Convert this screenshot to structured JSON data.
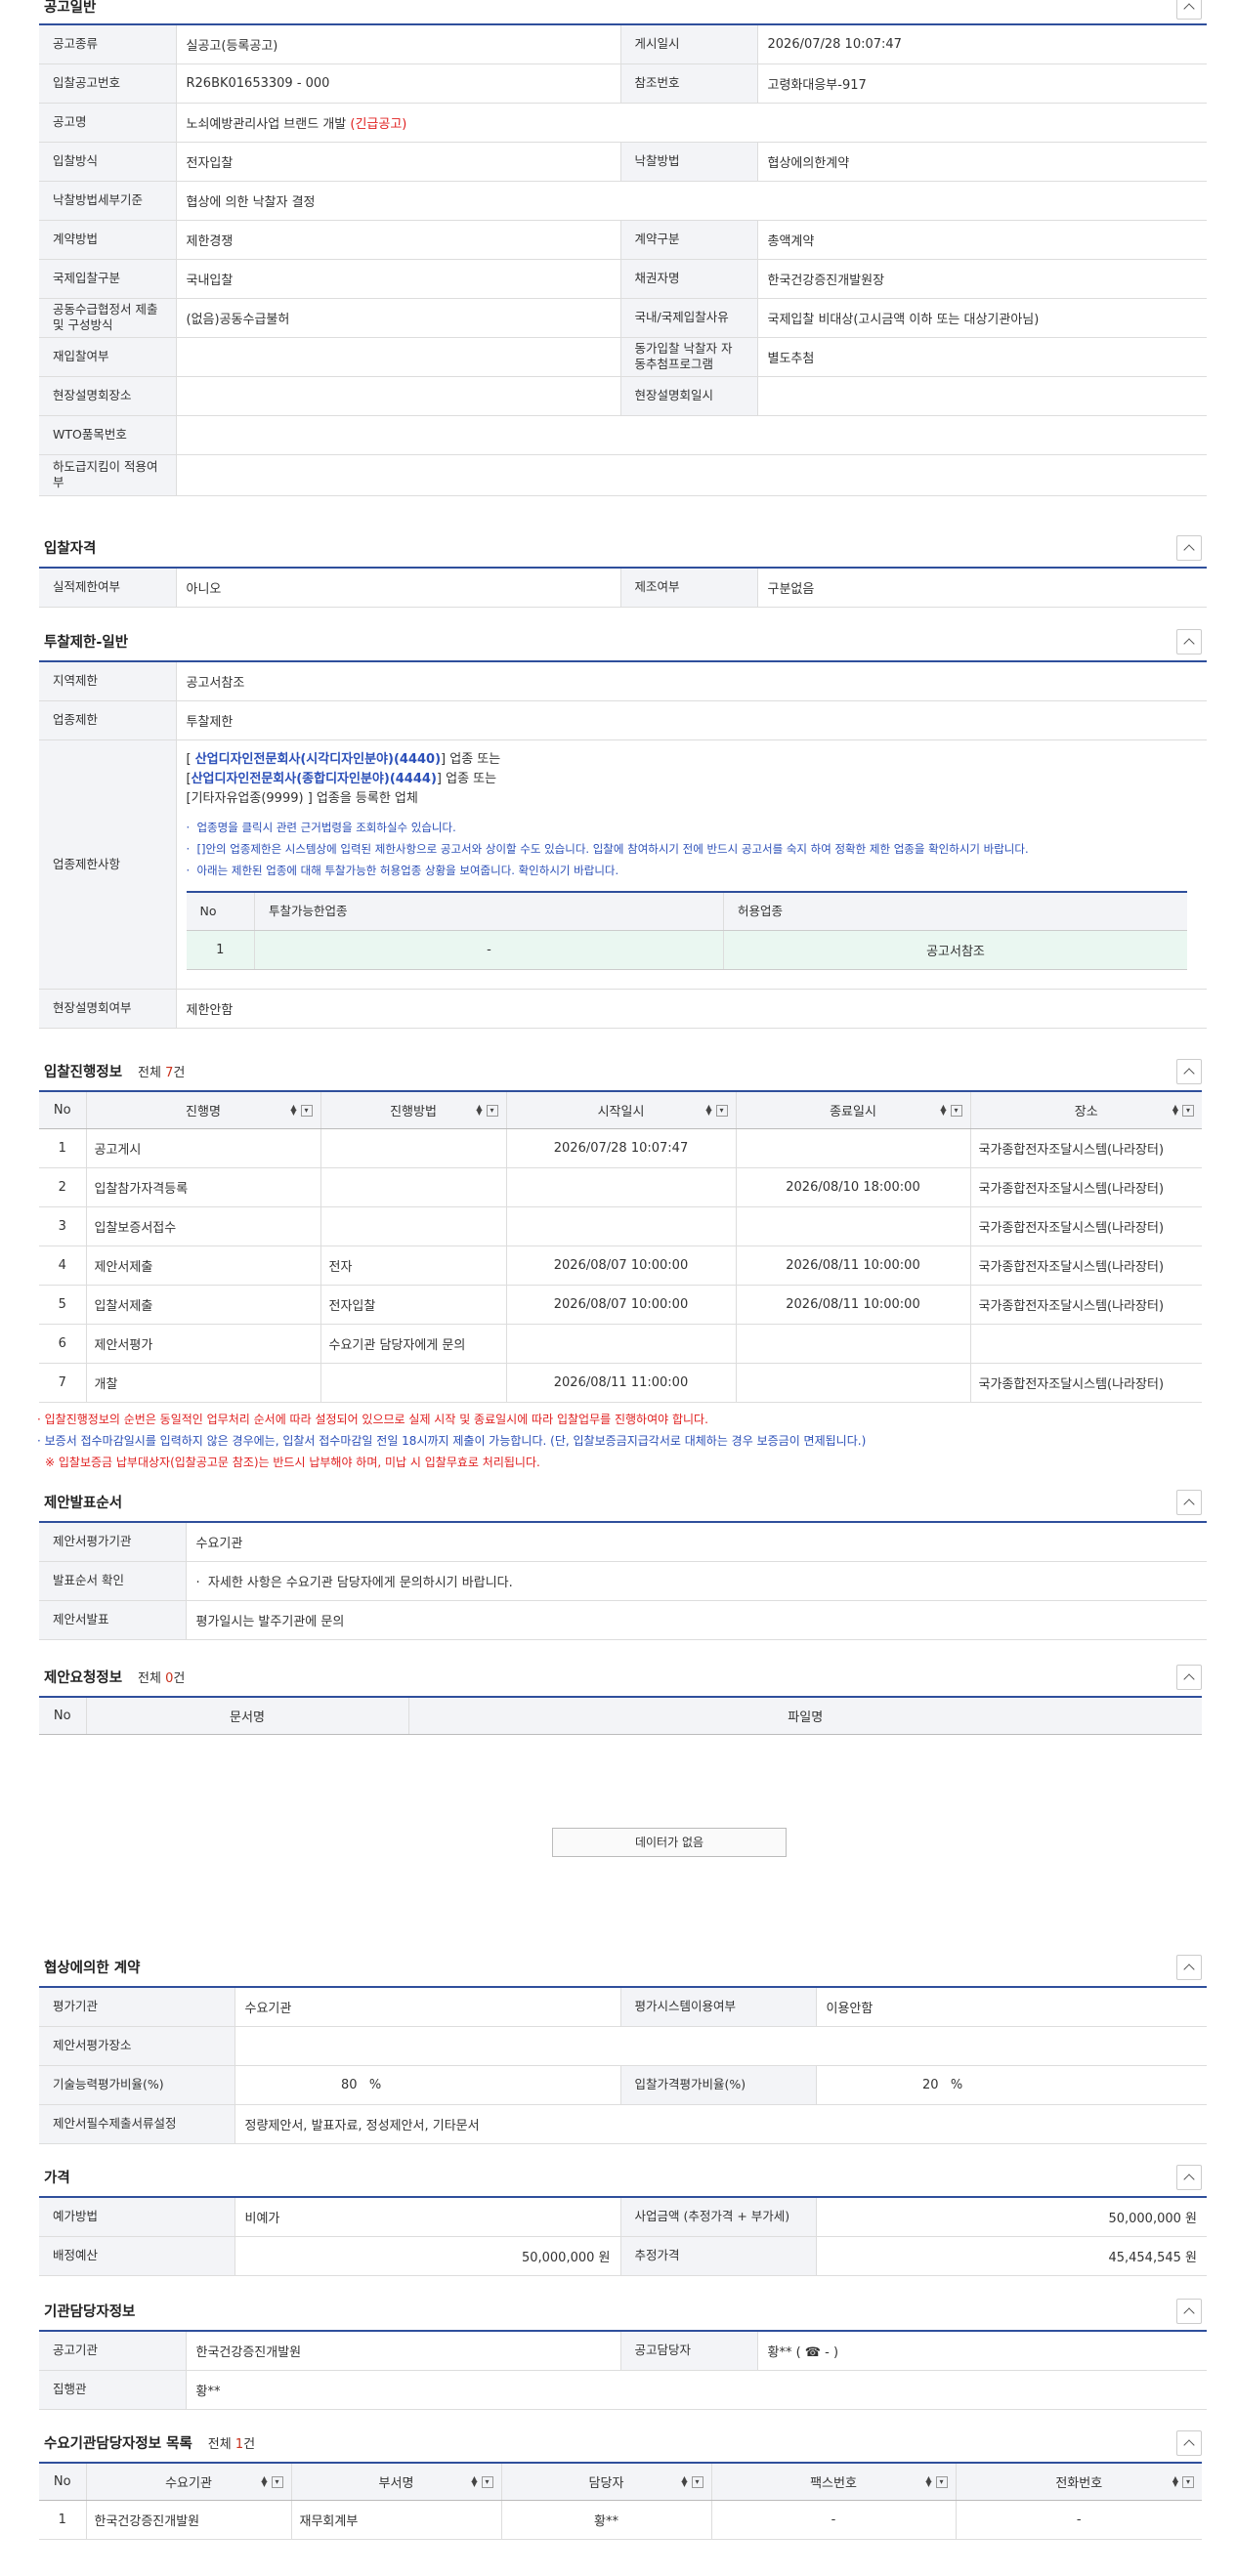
{
  "general": {
    "title": "공고일반",
    "rows": {
      "type_label": "공고종류",
      "type_value": "실공고(등록공고)",
      "posted_label": "게시일시",
      "posted_value": "2026/07/28 10:07:47",
      "bidno_label": "입찰공고번호",
      "bidno_value": "R26BK01653309 - 000",
      "ref_label": "참조번호",
      "ref_value": "고령화대응부-917",
      "name_label": "공고명",
      "name_value": "노쇠예방관리사업 브랜드 개발",
      "name_badge": "(긴급공고)",
      "method_label": "입찰방식",
      "method_value": "전자입찰",
      "award_label": "낙찰방법",
      "award_value": "협상에의한계약",
      "award_detail_label": "낙찰방법세부기준",
      "award_detail_value": "협상에 의한 낙찰자 결정",
      "contract_label": "계약방법",
      "contract_value": "제한경쟁",
      "contract_type_label": "계약구분",
      "contract_type_value": "총액계약",
      "intl_label": "국제입찰구분",
      "intl_value": "국내입찰",
      "creditor_label": "채권자명",
      "creditor_value": "한국건강증진개발원장",
      "joint_label": "공동수급협정서 제출 및 구성방식",
      "joint_value": "(없음)공동수급불허",
      "intl_reason_label": "국내/국제입찰사유",
      "intl_reason_value": "국제입찰 비대상(고시금액 이하 또는 대상기관아님)",
      "rebid_label": "재입찰여부",
      "rebid_value": "",
      "same_label": "동가입찰 낙찰자 자동추첨프로그램",
      "same_value": "별도추첨",
      "site_place_label": "현장설명회장소",
      "site_place_value": "",
      "site_time_label": "현장설명회일시",
      "site_time_value": "",
      "wto_label": "WTO품목번호",
      "wto_value": "",
      "subpay_label": "하도급지킴이 적용여부",
      "subpay_value": ""
    }
  },
  "qualification": {
    "title": "입찰자격",
    "perf_label": "실적제한여부",
    "perf_value": "아니오",
    "mfg_label": "제조여부",
    "mfg_value": "구분없음"
  },
  "restriction": {
    "title": "투찰제한-일반",
    "region_label": "지역제한",
    "region_value": "공고서참조",
    "industry_label": "업종제한",
    "industry_value": "투찰제한",
    "items_label": "업종제한사항",
    "line1_link": "산업디자인전문회사(시각디자인분야)(4440)",
    "line1_tail": "업종 또는",
    "line2_link": "산업디자인전문회사(종합디자인분야)(4444)",
    "line2_tail": "업종 또는",
    "line3": "[기타자유업종(9999) ] 업종을 등록한 업체",
    "bullet1": "업종명을 클릭시 관련 근거법령을 조회하실수 있습니다.",
    "bullet2": "[]안의 업종제한은 시스템상에 입력된 제한사항으로 공고서와 상이할 수도 있습니다. 입찰에 참여하시기 전에 반드시 공고서를 숙지 하여 정확한 제한 업종을 확인하시기 바랍니다.",
    "bullet3": "아래는 제한된 업종에 대해 투찰가능한 허용업종 상황을 보여줍니다. 확인하시기 바랍니다.",
    "inner_headers": [
      "No",
      "투찰가능한업종",
      "허용업종"
    ],
    "inner_row": [
      "1",
      "-",
      "공고서참조"
    ],
    "site_req_label": "현장설명회여부",
    "site_req_value": "제한안함"
  },
  "progress": {
    "title": "입찰진행정보",
    "count_prefix": "전체",
    "count": "7",
    "count_suffix": "건",
    "headers": [
      "No",
      "진행명",
      "진행방법",
      "시작일시",
      "종료일시",
      "장소"
    ],
    "rows": [
      [
        "1",
        "공고게시",
        "",
        "2026/07/28 10:07:47",
        "",
        "국가종합전자조달시스템(나라장터)"
      ],
      [
        "2",
        "입찰참가자격등록",
        "",
        "",
        "2026/08/10 18:00:00",
        "국가종합전자조달시스템(나라장터)"
      ],
      [
        "3",
        "입찰보증서접수",
        "",
        "",
        "",
        "국가종합전자조달시스템(나라장터)"
      ],
      [
        "4",
        "제안서제출",
        "전자",
        "2026/08/07 10:00:00",
        "2026/08/11 10:00:00",
        "국가종합전자조달시스템(나라장터)"
      ],
      [
        "5",
        "입찰서제출",
        "전자입찰",
        "2026/08/07 10:00:00",
        "2026/08/11 10:00:00",
        "국가종합전자조달시스템(나라장터)"
      ],
      [
        "6",
        "제안서평가",
        "수요기관 담당자에게 문의",
        "",
        "",
        ""
      ],
      [
        "7",
        "개찰",
        "",
        "2026/08/11 11:00:00",
        "",
        "국가종합전자조달시스템(나라장터)"
      ]
    ],
    "note1": "입찰진행정보의 순번은 동일적인 업무처리 순서에 따라 설정되어 있으므로 실제 시작 및 종료일시에 따라 입찰업무를 진행하여야 합니다.",
    "note2": "보증서 접수마감일시를 입력하지 않은 경우에는, 입찰서 접수마감일 전일 18시까지 제출이 가능합니다. (단, 입찰보증금지급각서로 대체하는 경우 보증금이 면제됩니다.)",
    "note3": "※ 입찰보증금 납부대상자(입찰공고문 참조)는 반드시 납부해야 하며, 미납 시 입찰무효로 처리됩니다."
  },
  "presentation": {
    "title": "제안발표순서",
    "eval_org_label": "제안서평가기관",
    "eval_org_value": "수요기관",
    "order_label": "발표순서 확인",
    "order_value": "자세한 사항은 수요기관 담당자에게 문의하시기 바랍니다.",
    "pres_label": "제안서발표",
    "pres_value": "평가일시는 발주기관에 문의"
  },
  "request": {
    "title": "제안요청정보",
    "count_prefix": "전체",
    "count": "0",
    "count_suffix": "건",
    "headers": [
      "No",
      "문서명",
      "파일명"
    ],
    "empty": "데이터가 없음"
  },
  "negotiation": {
    "title": "협상에의한 계약",
    "eval_label": "평가기관",
    "eval_value": "수요기관",
    "system_label": "평가시스템이용여부",
    "system_value": "이용안함",
    "place_label": "제안서평가장소",
    "place_value": "",
    "tech_label": "기술능력평가비율(%)",
    "tech_value": "80",
    "tech_unit": "%",
    "price_label": "입찰가격평가비율(%)",
    "price_value": "20",
    "price_unit": "%",
    "docs_label": "제안서필수제출서류설정",
    "docs_value": "정량제안서, 발표자료, 정성제안서, 기타문서"
  },
  "price": {
    "title": "가격",
    "method_label": "예가방법",
    "method_value": "비예가",
    "biz_label": "사업금액 (추정가격 + 부가세)",
    "biz_value": "50,000,000 원",
    "budget_label": "배정예산",
    "budget_value": "50,000,000 원",
    "est_label": "추정가격",
    "est_value": "45,454,545 원"
  },
  "agency": {
    "title": "기관담당자정보",
    "org_label": "공고기관",
    "org_value": "한국건강증진개발원",
    "manager_label": "공고담당자",
    "manager_value": "황** ( ☎ - )",
    "exec_label": "집행관",
    "exec_value": "황**"
  },
  "contacts": {
    "title": "수요기관담당자정보 목록",
    "count_prefix": "전체",
    "count": "1",
    "count_suffix": "건",
    "headers": [
      "No",
      "수요기관",
      "부서명",
      "담당자",
      "팩스번호",
      "전화번호"
    ],
    "rows": [
      [
        "1",
        "한국건강증진개발원",
        "재무회계부",
        "황**",
        "-",
        "-"
      ]
    ]
  },
  "colors": {
    "accent": "#2f4f9c",
    "red": "#e02020",
    "blue": "#2b4fb8"
  }
}
